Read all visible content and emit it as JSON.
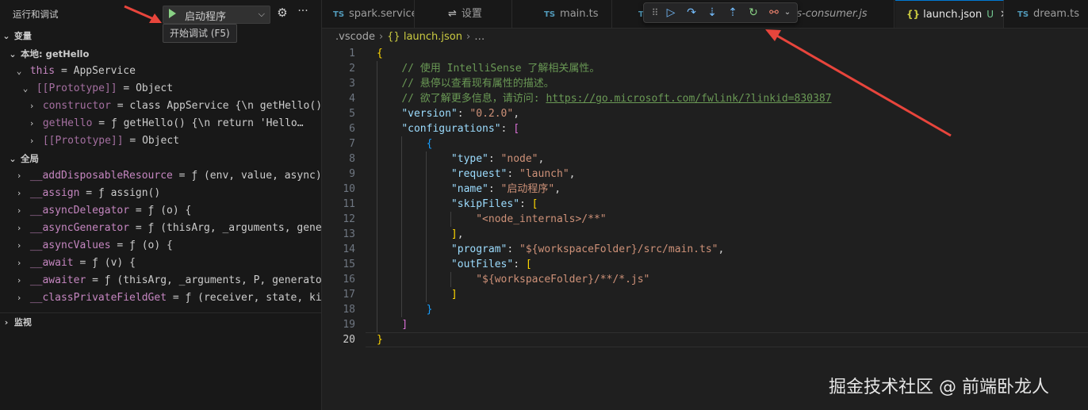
{
  "sidebar": {
    "title": "运行和调试",
    "launch_config": "启动程序",
    "tooltip": "开始调试 (F5)",
    "sections": {
      "variables": "变量",
      "watch": "监视"
    },
    "scopes": {
      "local": "本地: getHello",
      "global": "全局"
    },
    "local_items": [
      {
        "name": "this",
        "value": "AppService"
      },
      {
        "name": "[[Prototype]]",
        "value": "Object"
      },
      {
        "name": "constructor",
        "value": "class AppService {\\n    getHello()…"
      },
      {
        "name": "getHello",
        "value": "ƒ getHello() {\\n        return 'Hello…"
      },
      {
        "name": "[[Prototype]]",
        "value": "Object"
      }
    ],
    "global_items": [
      {
        "name": "__addDisposableResource",
        "value": "ƒ (env, value, async) {"
      },
      {
        "name": "__assign",
        "value": "ƒ assign()"
      },
      {
        "name": "__asyncDelegator",
        "value": "ƒ (o) {"
      },
      {
        "name": "__asyncGenerator",
        "value": "ƒ (thisArg, _arguments, generato…"
      },
      {
        "name": "__asyncValues",
        "value": "ƒ (o) {"
      },
      {
        "name": "__await",
        "value": "ƒ (v) {"
      },
      {
        "name": "__awaiter",
        "value": "ƒ (thisArg, _arguments, P, generator) {"
      },
      {
        "name": "__classPrivateFieldGet",
        "value": "ƒ (receiver, state, kind, …"
      }
    ]
  },
  "tabs": [
    {
      "badge": "TS",
      "label": "spark.service.ts"
    },
    {
      "badge": "settings",
      "label": "设置"
    },
    {
      "badge": "TS",
      "label": "main.ts"
    },
    {
      "badge": "TS",
      "label": "…tors-consumer.js"
    },
    {
      "badge": "{}",
      "label": "launch.json",
      "status": "U"
    },
    {
      "badge": "TS",
      "label": "dream.ts"
    }
  ],
  "breadcrumb": [
    ".vscode",
    "{} launch.json",
    "…"
  ],
  "code_lines": [
    {
      "n": "1"
    },
    {
      "n": "2"
    },
    {
      "n": "3"
    },
    {
      "n": "4"
    },
    {
      "n": "5"
    },
    {
      "n": "6"
    },
    {
      "n": "7"
    },
    {
      "n": "8"
    },
    {
      "n": "9"
    },
    {
      "n": "10"
    },
    {
      "n": "11"
    },
    {
      "n": "12"
    },
    {
      "n": "13"
    },
    {
      "n": "14"
    },
    {
      "n": "15"
    },
    {
      "n": "16"
    },
    {
      "n": "17"
    },
    {
      "n": "18"
    },
    {
      "n": "19"
    },
    {
      "n": "20"
    }
  ],
  "code": {
    "l2": "// 使用 IntelliSense 了解相关属性。",
    "l3": "// 悬停以查看现有属性的描述。",
    "l4_text": "// 欲了解更多信息，请访问: ",
    "l4_link": "https://go.microsoft.com/fwlink/?linkid=830387",
    "version_key": "\"version\"",
    "version_val": "\"0.2.0\"",
    "configs_key": "\"configurations\"",
    "type_key": "\"type\"",
    "type_val": "\"node\"",
    "request_key": "\"request\"",
    "request_val": "\"launch\"",
    "name_key": "\"name\"",
    "name_val": "\"启动程序\"",
    "skip_key": "\"skipFiles\"",
    "skip_val": "\"<node_internals>/**\"",
    "program_key": "\"program\"",
    "program_val": "\"${workspaceFolder}/src/main.ts\"",
    "out_key": "\"outFiles\"",
    "out_val": "\"${workspaceFolder}/**/*.js\""
  },
  "watermark": "掘金技术社区 @ 前端卧龙人",
  "colors": {
    "accent": "#0078d4",
    "annotation_arrow": "#e8453c"
  }
}
